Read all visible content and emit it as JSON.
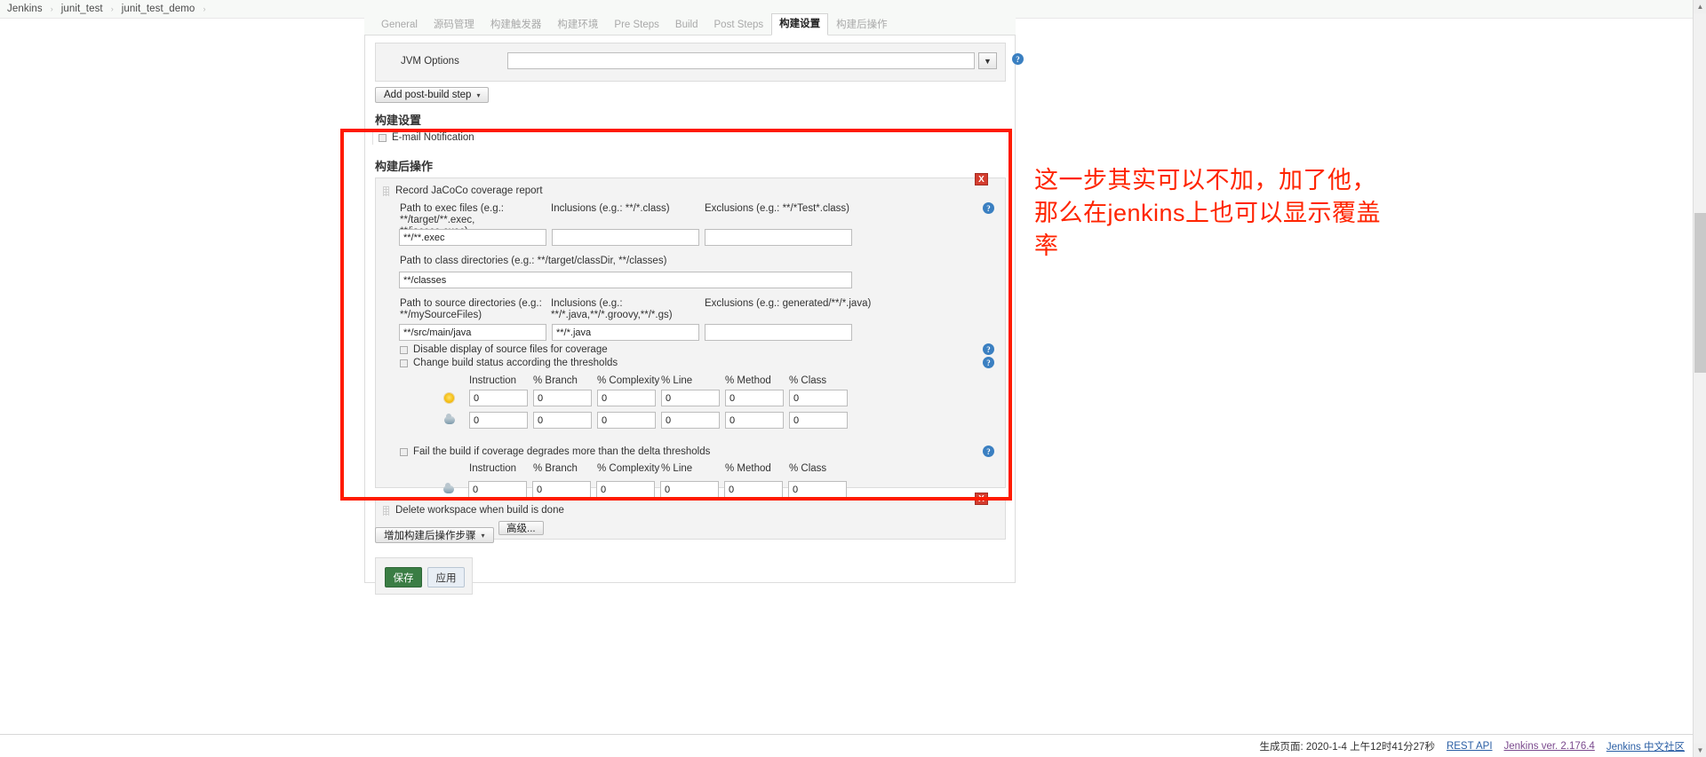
{
  "breadcrumb": {
    "items": [
      "Jenkins",
      "junit_test",
      "junit_test_demo"
    ],
    "separator": "›"
  },
  "tabs": [
    {
      "label": "General",
      "active": false
    },
    {
      "label": "源码管理",
      "active": false
    },
    {
      "label": "构建触发器",
      "active": false
    },
    {
      "label": "构建环境",
      "active": false
    },
    {
      "label": "Pre Steps",
      "active": false
    },
    {
      "label": "Build",
      "active": false
    },
    {
      "label": "Post Steps",
      "active": false
    },
    {
      "label": "构建设置",
      "active": true
    },
    {
      "label": "构建后操作",
      "active": false
    }
  ],
  "jvm": {
    "label": "JVM Options",
    "value": "",
    "dropdown_caret": "▼",
    "help": "?"
  },
  "add_post_build_step": {
    "label": "Add post-build step",
    "caret": "▾"
  },
  "build_settings": {
    "title": "构建设置",
    "email_notification": "E-mail Notification"
  },
  "post_build": {
    "title": "构建后操作",
    "jacoco": {
      "title": "Record JaCoCo coverage report",
      "remove_label": "X",
      "help": "?",
      "exec": {
        "label_line1": "Path to exec files (e.g.:",
        "label_line2": "**/target/**.exec, **/jacoco.exec)",
        "value": "**/**.exec"
      },
      "exec_inclusions": {
        "label": "Inclusions (e.g.: **/*.class)",
        "value": ""
      },
      "exec_exclusions": {
        "label": "Exclusions (e.g.: **/*Test*.class)",
        "value": ""
      },
      "class_dirs": {
        "label": "Path to class directories (e.g.: **/target/classDir, **/classes)",
        "value": "**/classes"
      },
      "source_dirs": {
        "label_line1": "Path to source directories (e.g.:",
        "label_line2": "**/mySourceFiles)",
        "value": "**/src/main/java"
      },
      "source_inclusions": {
        "label_line1": "Inclusions (e.g.:",
        "label_line2": "**/*.java,**/*.groovy,**/*.gs)",
        "value": "**/*.java"
      },
      "source_exclusions": {
        "label": "Exclusions (e.g.: generated/**/*.java)",
        "value": ""
      },
      "disable_display": "Disable display of source files for coverage",
      "change_status": "Change build status according the thresholds",
      "fail_build": "Fail the build if coverage degrades more than the delta thresholds",
      "threshold_columns": [
        "Instruction",
        "% Branch",
        "% Complexity",
        "% Line",
        "% Method",
        "% Class"
      ],
      "threshold_rows": [
        {
          "icon": "sunny-icon",
          "values": [
            "0",
            "0",
            "0",
            "0",
            "0",
            "0"
          ]
        },
        {
          "icon": "cloudy-icon",
          "values": [
            "0",
            "0",
            "0",
            "0",
            "0",
            "0"
          ]
        }
      ],
      "delta_rows": [
        {
          "icon": "cloudy-icon",
          "values": [
            "0",
            "0",
            "0",
            "0",
            "0",
            "0"
          ]
        }
      ]
    },
    "delete_workspace": {
      "label": "Delete workspace when build is done",
      "remove_label": "X"
    },
    "advanced_button": "高级...",
    "add_step_button": {
      "label": "增加构建后操作步骤",
      "caret": "▾"
    }
  },
  "actions": {
    "save": "保存",
    "apply": "应用"
  },
  "annotation": {
    "text": "这一步其实可以不加，加了他，那么在jenkins上也可以显示覆盖率",
    "color": "#ff2400"
  },
  "footer": {
    "generated": "生成页面: 2020-1-4 上午12时41分27秒",
    "rest_api": "REST API",
    "version": "Jenkins ver. 2.176.4",
    "community": "Jenkins 中文社区"
  },
  "colors": {
    "accent_red": "#ff1a00",
    "help_blue": "#3a7fc1",
    "remove_red": "#d43d2f",
    "save_green": "#3a7d44"
  }
}
